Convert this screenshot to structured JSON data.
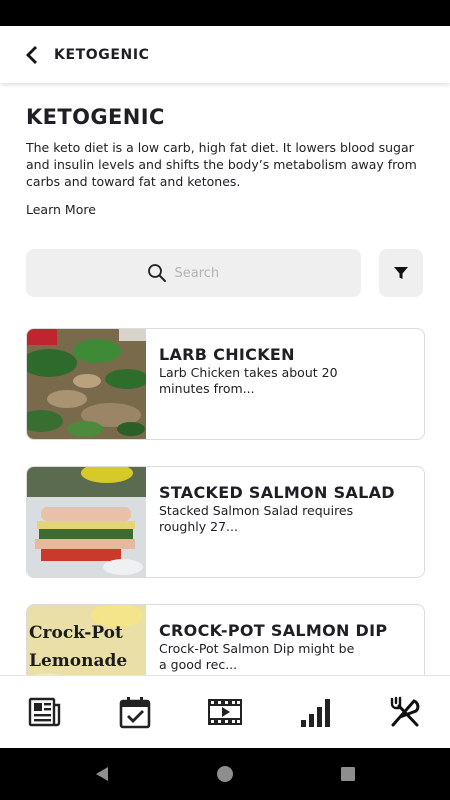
{
  "app_bar": {
    "title": "KETOGENIC",
    "back_icon": "arrow-left-icon"
  },
  "page": {
    "title": "KETOGENIC",
    "description": "The keto diet is a low carb, high fat diet. It lowers blood sugar and insulin levels and shifts the body’s metabolism away from carbs and toward fat and ketones.",
    "learn_more": "Learn More"
  },
  "search": {
    "placeholder": "Search",
    "value": "",
    "icon": "search-icon",
    "filter_icon": "filter-icon"
  },
  "recipes": [
    {
      "title": "LARB CHICKEN",
      "summary": "Larb Chicken takes about 20 minutes from..."
    },
    {
      "title": "STACKED SALMON SALAD",
      "summary": "Stacked Salmon Salad requires roughly 27..."
    },
    {
      "title": "CROCK-POT SALMON DIP",
      "summary": "Crock-Pot Salmon Dip might be a good rec...",
      "image_text": [
        "Crock-Pot",
        "Lemonade"
      ]
    }
  ],
  "bottom_nav": [
    {
      "name": "news",
      "icon": "newspaper-icon"
    },
    {
      "name": "plan",
      "icon": "calendar-check-icon"
    },
    {
      "name": "videos",
      "icon": "video-film-icon"
    },
    {
      "name": "progress",
      "icon": "bar-chart-icon"
    },
    {
      "name": "recipes",
      "icon": "fork-knife-icon",
      "active": true
    }
  ],
  "system_nav": [
    "back-triangle-icon",
    "home-circle-icon",
    "recents-square-icon"
  ],
  "colors": {
    "text": "#1e1e24",
    "input_bg": "#efefef",
    "card_border": "#dcdcdc",
    "system_bar": "#000000"
  }
}
